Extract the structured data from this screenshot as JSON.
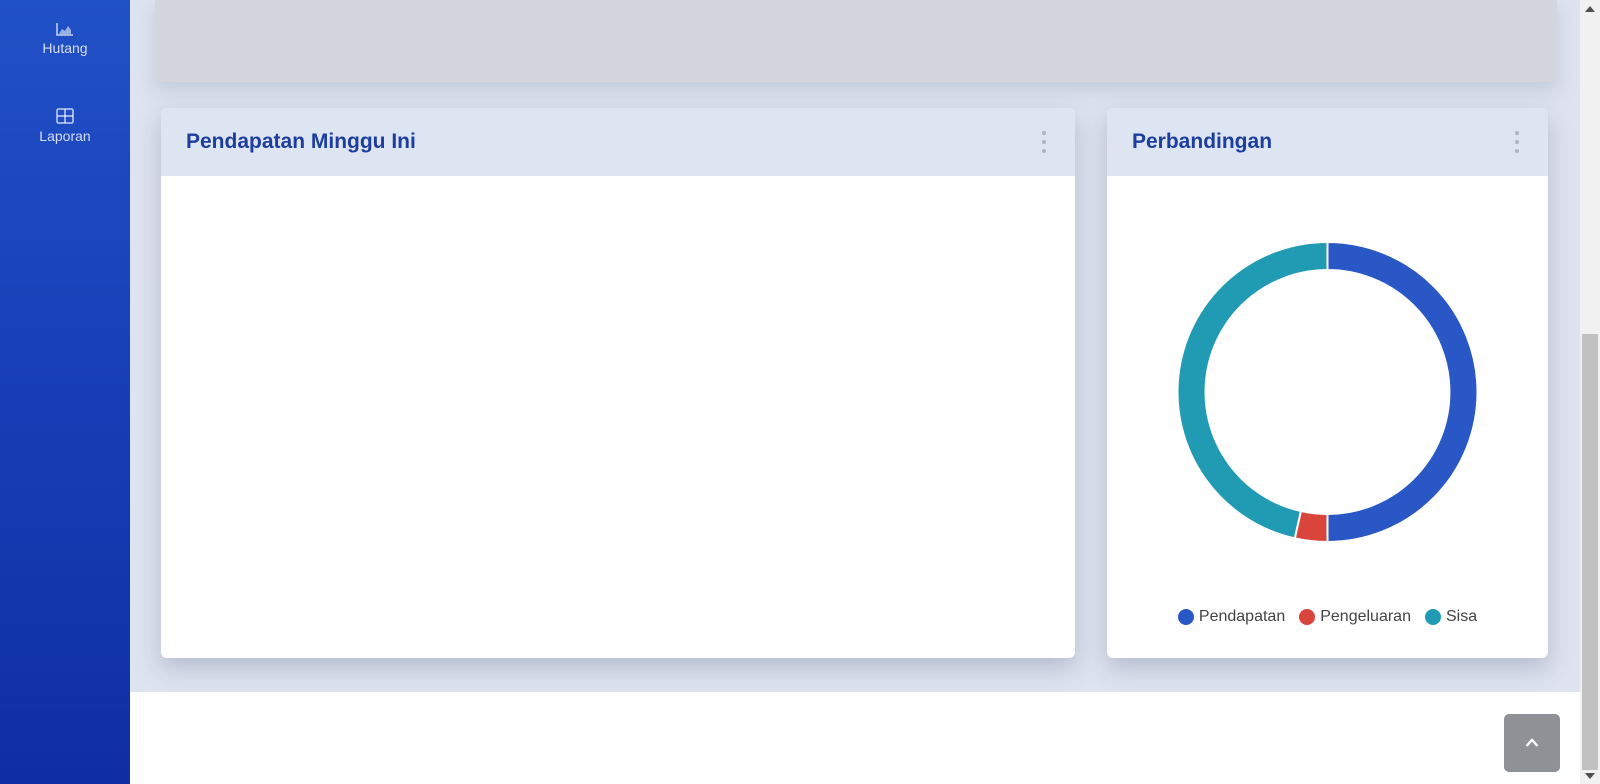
{
  "sidebar": {
    "items": [
      {
        "label": "Hutang",
        "icon": "area-chart-icon"
      },
      {
        "label": "Laporan",
        "icon": "table-icon"
      }
    ]
  },
  "cards": {
    "weekly_income": {
      "title": "Pendapatan Minggu Ini"
    },
    "comparison": {
      "title": "Perbandingan"
    }
  },
  "chart_data": {
    "type": "pie",
    "variant": "donut",
    "categories": [
      "Pendapatan",
      "Pengeluaran",
      "Sisa"
    ],
    "values": [
      50,
      3.5,
      46.5
    ],
    "colors": [
      "#2a57c6",
      "#d9453b",
      "#219bb3"
    ],
    "legend_position": "bottom"
  },
  "buttons": {
    "back_to_top_icon": "chevron-up-icon"
  },
  "colors": {
    "sidebar": "#1840b8",
    "title": "#1d3e9e",
    "card_header": "#dde5f3"
  }
}
